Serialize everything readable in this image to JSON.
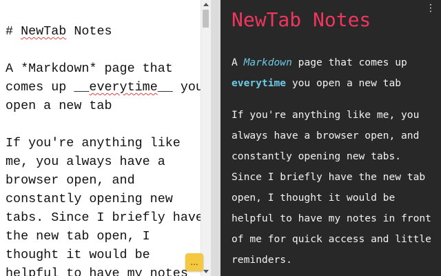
{
  "editor": {
    "lines": [
      {
        "parts": [
          {
            "text": "# "
          },
          {
            "text": "NewTab",
            "spell": true
          },
          {
            "text": " Notes"
          }
        ]
      },
      {
        "parts": [
          {
            "text": ""
          }
        ]
      },
      {
        "parts": [
          {
            "text": "A *Markdown* page that"
          }
        ]
      },
      {
        "parts": [
          {
            "text": "comes up __"
          },
          {
            "text": "everytime",
            "spell": true
          },
          {
            "text": "__ you"
          }
        ]
      },
      {
        "parts": [
          {
            "text": "open a new tab"
          }
        ]
      },
      {
        "parts": [
          {
            "text": ""
          }
        ]
      },
      {
        "parts": [
          {
            "text": "If you're anything like"
          }
        ]
      },
      {
        "parts": [
          {
            "text": "me, you always have a"
          }
        ]
      },
      {
        "parts": [
          {
            "text": "browser open, and"
          }
        ]
      },
      {
        "parts": [
          {
            "text": "constantly opening new"
          }
        ]
      },
      {
        "parts": [
          {
            "text": "tabs. Since I briefly have"
          }
        ]
      },
      {
        "parts": [
          {
            "text": "the new tab open, I"
          }
        ]
      },
      {
        "parts": [
          {
            "text": "thought it would be"
          }
        ]
      },
      {
        "parts": [
          {
            "text": "helpful to have my notes"
          }
        ]
      }
    ],
    "more_button_label": "..."
  },
  "preview": {
    "title": "NewTab Notes",
    "menu_icon_glyph": "⋮",
    "intro": {
      "prefix": "A ",
      "emphasis": "Markdown",
      "middle": " page that comes up ",
      "strong": "everytime",
      "suffix": " you open a new tab"
    },
    "paragraph": "If you're anything like me, you always have a browser open, and constantly opening new tabs. Since I briefly have the new tab open, I thought it would be helpful to have my notes in front of me for quick access and little reminders."
  },
  "colors": {
    "preview_background": "#282828",
    "title": "#f0365f",
    "markdown_accent": "#6ec9e4",
    "more_button": "#f5c842"
  }
}
